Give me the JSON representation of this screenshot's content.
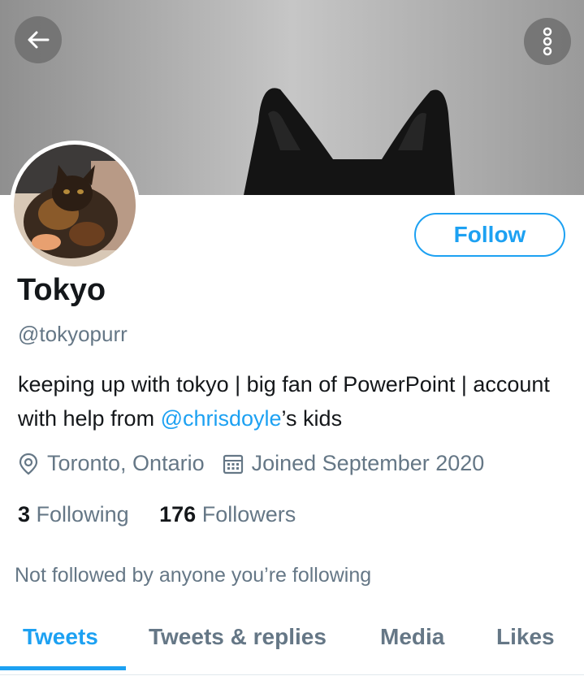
{
  "profile": {
    "name": "Tokyo",
    "handle": "@tokyopurr",
    "bio_part1": "keeping up with tokyo | big fan of PowerPoint | account with help from ",
    "bio_mention": "@chrisdoyle",
    "bio_part2": "’s kids",
    "location": "Toronto, Ontario",
    "joined": "Joined September 2020",
    "following_count": "3",
    "following_label": "Following",
    "followers_count": "176",
    "followers_label": "Followers",
    "not_followed_text": "Not followed by anyone you’re following"
  },
  "actions": {
    "follow_label": "Follow",
    "back_icon": "arrow-left-icon",
    "more_icon": "more-vertical-icon"
  },
  "tabs": [
    {
      "label": "Tweets",
      "active": true
    },
    {
      "label": "Tweets & replies",
      "active": false
    },
    {
      "label": "Media",
      "active": false
    },
    {
      "label": "Likes",
      "active": false
    }
  ],
  "colors": {
    "accent": "#1da1f2",
    "secondary_text": "#657786",
    "primary_text": "#14171a"
  }
}
